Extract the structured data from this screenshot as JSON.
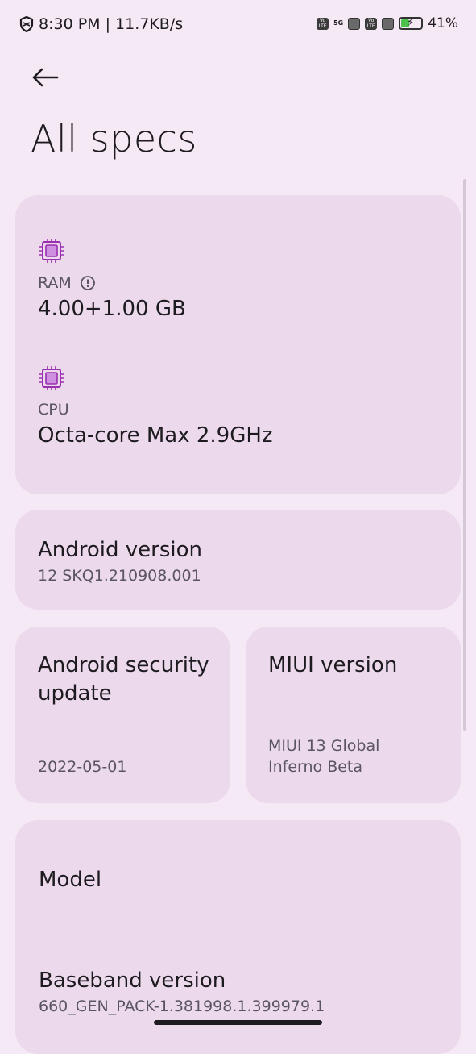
{
  "status": {
    "time_speed": "8:30 PM | 11.7KB/s",
    "net_5g": "5G",
    "volte": "Vo LTE",
    "battery": "41%",
    "battery_level": 0.41,
    "icons": [
      "shield-icon",
      "volte-icon",
      "5g-icon",
      "sim-icon",
      "battery-icon"
    ]
  },
  "header": {
    "title": "All specs"
  },
  "specs": {
    "ram_label": "RAM",
    "ram_value": "4.00+1.00 GB",
    "cpu_label": "CPU",
    "cpu_value": "Octa-core Max 2.9GHz"
  },
  "android_version": {
    "title": "Android version",
    "value": "12 SKQ1.210908.001"
  },
  "security_update": {
    "title_line1": "Android security",
    "title_line2": "update",
    "value": "2022-05-01"
  },
  "miui_version": {
    "title": "MIUI version",
    "value_line1": "MIUI 13 Global",
    "value_line2": "Inferno Beta"
  },
  "device": {
    "model_title": "Model",
    "baseband_title": "Baseband version",
    "baseband_value": "660_GEN_PACK-1.381998.1.399979.1"
  },
  "colors": {
    "background": "#f5e9f5",
    "card": "#ecdaec",
    "accent": "#9a2fb0"
  }
}
